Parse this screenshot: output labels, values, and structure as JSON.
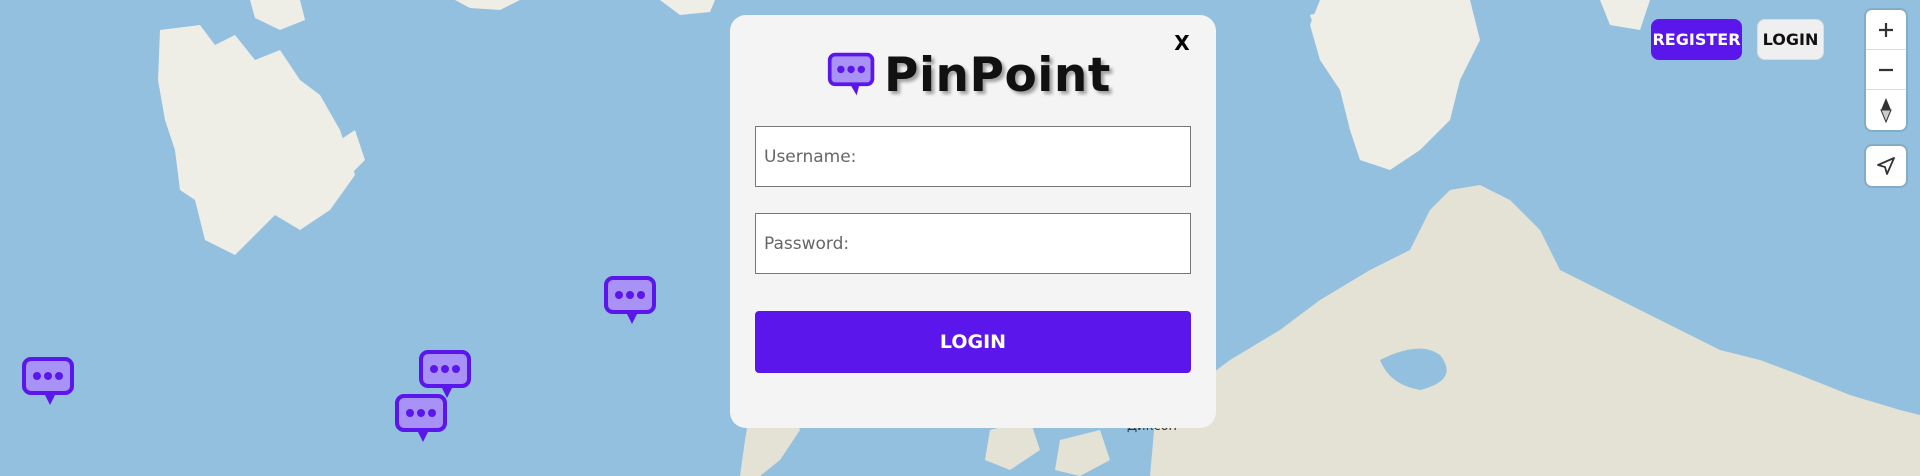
{
  "app": {
    "brand_name": "PinPoint",
    "accent_color": "#5b16ec"
  },
  "header": {
    "register_label": "REGISTER",
    "login_label": "LOGIN"
  },
  "map_controls": {
    "zoom_in_icon": "plus-icon",
    "zoom_out_icon": "minus-icon",
    "compass_icon": "compass-icon",
    "locate_icon": "locate-arrow-icon"
  },
  "modal": {
    "close_label": "X",
    "username_placeholder": "Username:",
    "password_placeholder": "Password:",
    "submit_label": "LOGIN"
  },
  "map": {
    "city_label": "Диксон",
    "pin_count_visible": 4
  }
}
